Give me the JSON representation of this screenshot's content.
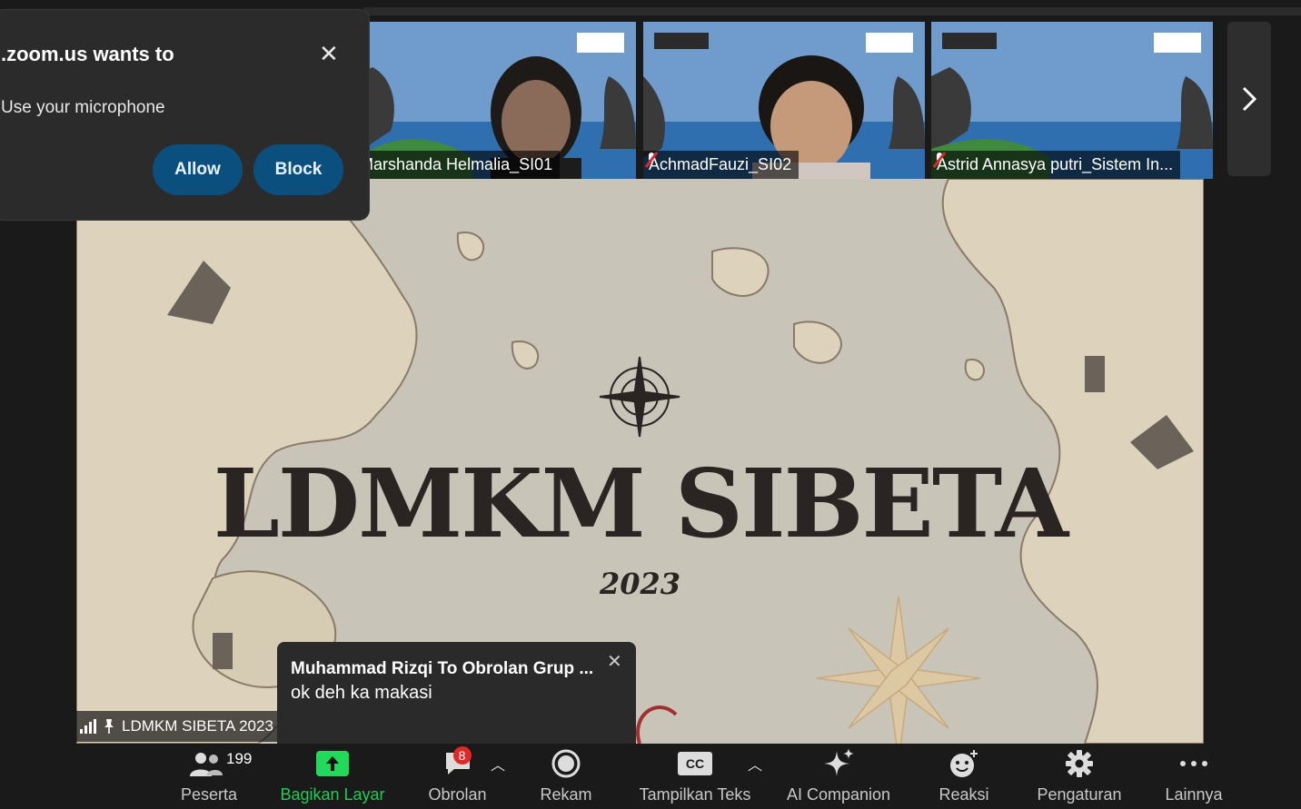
{
  "permission_popup": {
    "title": ".zoom.us wants to",
    "item": "Use your microphone",
    "allow_label": "Allow",
    "block_label": "Block"
  },
  "participants_strip": [
    {
      "name": "Marshanda Helmalia_SI01"
    },
    {
      "name": "AchmadFauzi_SI02"
    },
    {
      "name": "Astrid Annasya putri_Sistem In..."
    }
  ],
  "shared_screen": {
    "title": "LDMKM SIBETA",
    "year": "2023",
    "share_label": "LDMKM SIBETA 2023"
  },
  "chat_toast": {
    "sender": "Muhammad Rizqi To Obrolan Grup ...",
    "message": "ok deh ka makasi"
  },
  "toolbar": {
    "participants_label": "Peserta",
    "participants_count": "199",
    "share_label": "Bagikan Layar",
    "chat_label": "Obrolan",
    "chat_badge": "8",
    "record_label": "Rekam",
    "captions_label": "Tampilkan Teks",
    "captions_icon_text": "CC",
    "ai_label": "AI Companion",
    "reactions_label": "Reaksi",
    "settings_label": "Pengaturan",
    "more_label": "Lainnya"
  },
  "colors": {
    "accent_green": "#23d959",
    "share_label_green": "#22cc55",
    "popup_button": "#0b4f7f",
    "badge_red": "#e02828"
  }
}
